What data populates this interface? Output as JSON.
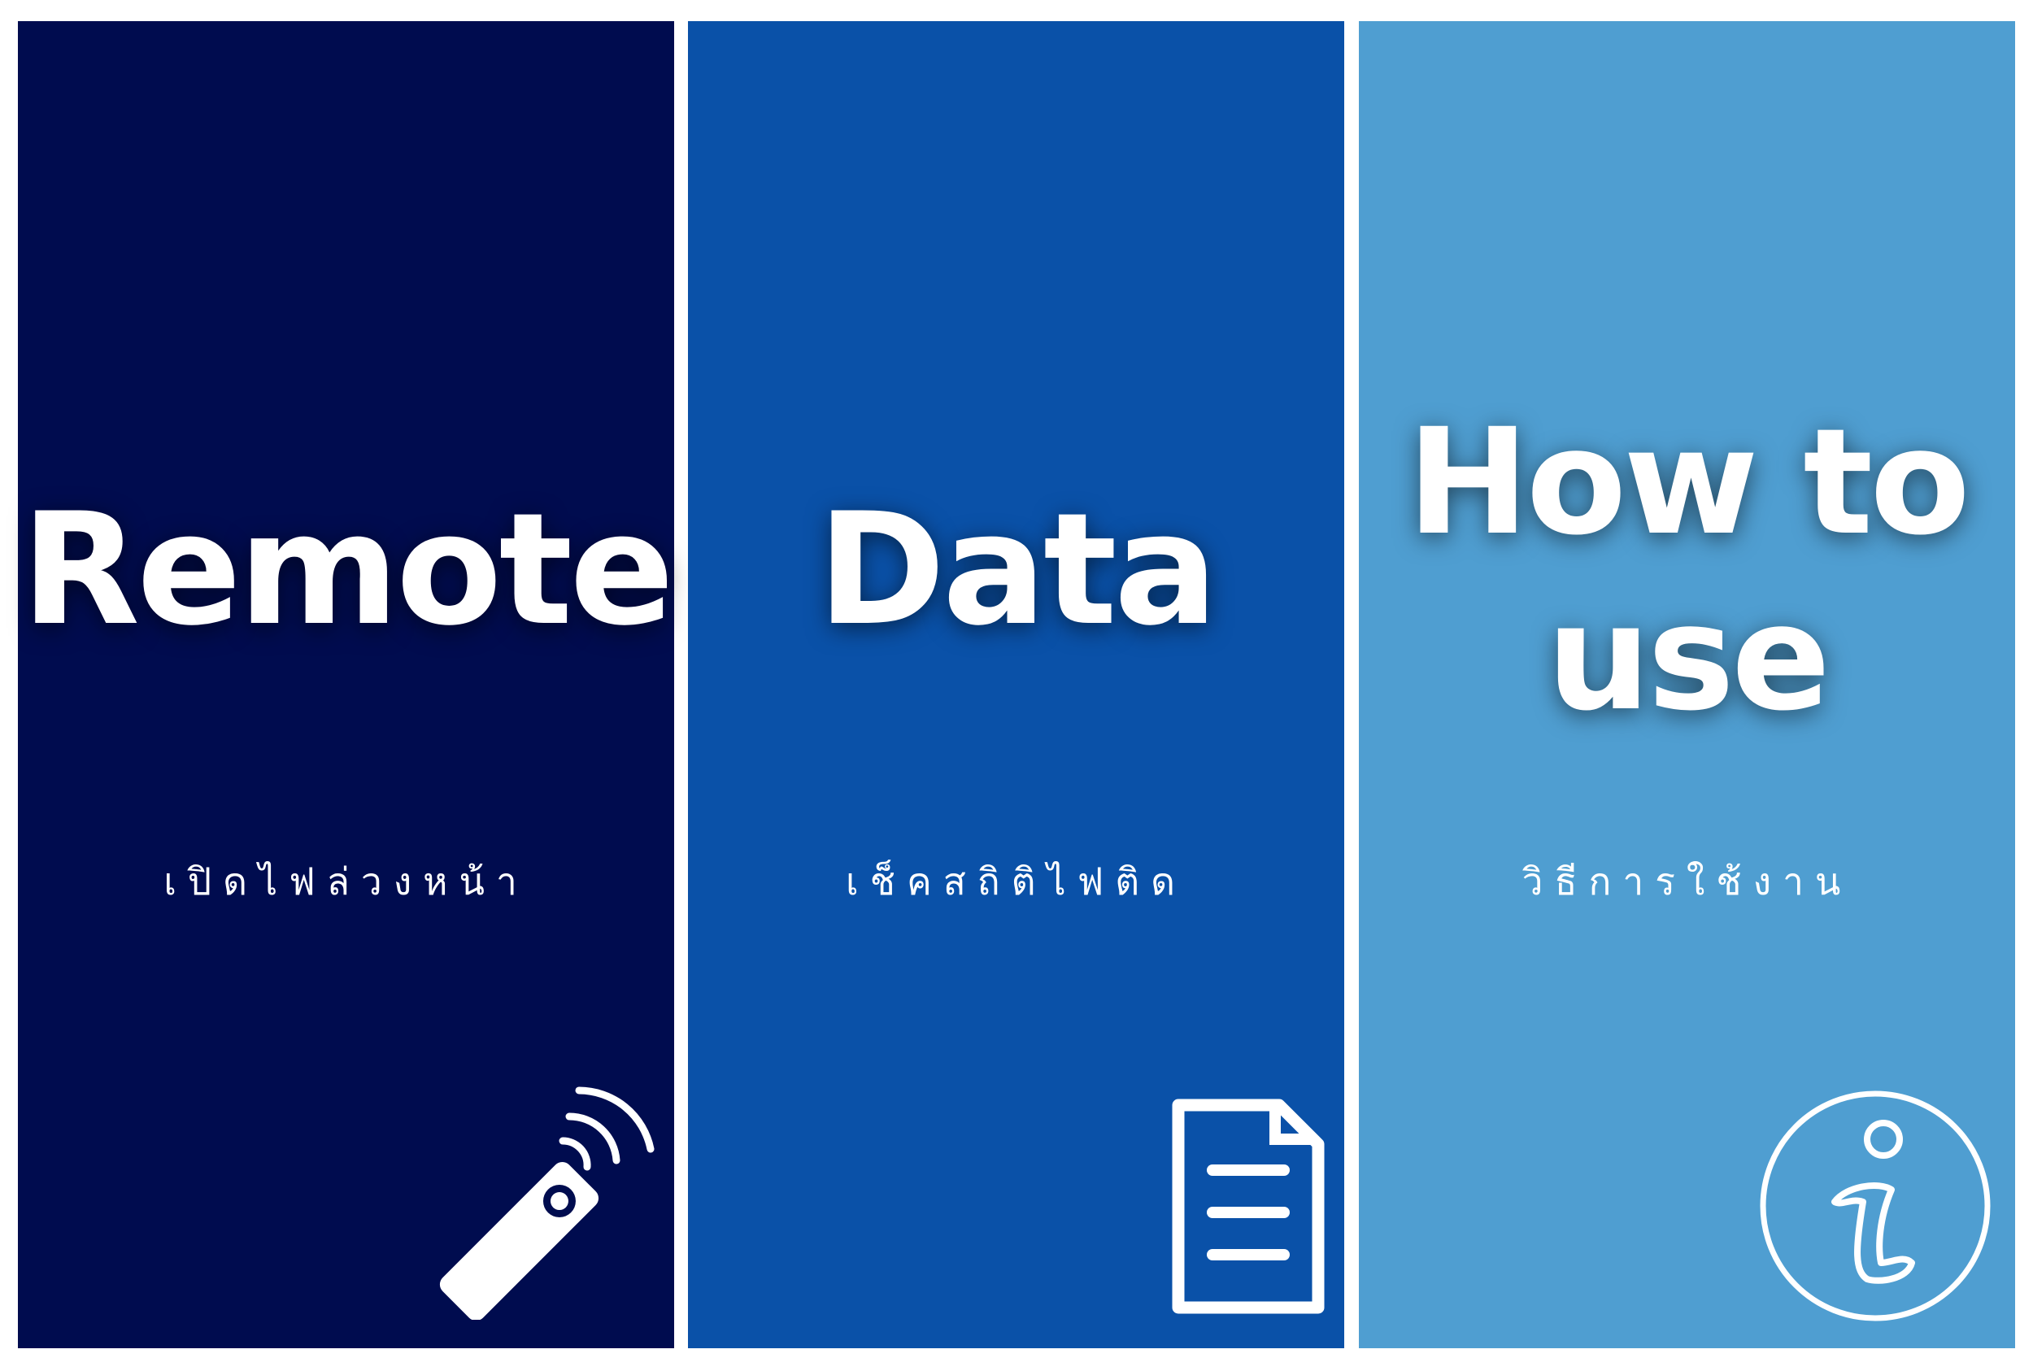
{
  "panels": [
    {
      "title": "Remote",
      "subtitle": "เปิดไฟล่วงหน้า",
      "icon": "remote-control-icon",
      "color": "#000c4f"
    },
    {
      "title": "Data",
      "subtitle": "เช็คสถิติไฟติด",
      "icon": "document-icon",
      "color": "#0a51a8"
    },
    {
      "title_line1": "How to",
      "title_line2": "use",
      "subtitle": "วิธีการใช้งาน",
      "icon": "info-icon",
      "color": "#4f9ed1"
    }
  ]
}
